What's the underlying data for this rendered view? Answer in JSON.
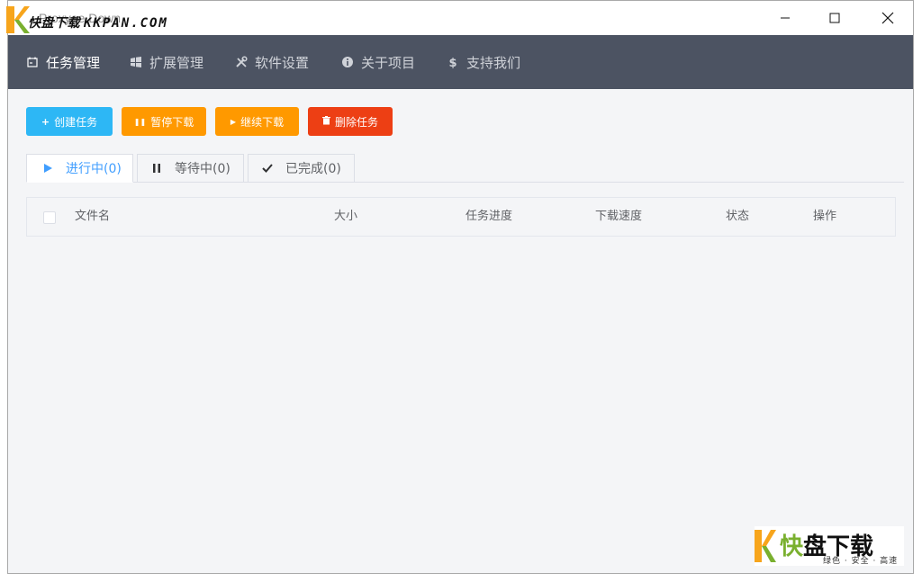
{
  "window": {
    "title": "Proxyee Down",
    "watermark_brand": "快盘下载",
    "watermark_domain": "KKPAN.COM"
  },
  "nav": {
    "items": [
      {
        "label": "任务管理",
        "icon": "calendar-icon",
        "active": true
      },
      {
        "label": "扩展管理",
        "icon": "windows-icon",
        "active": false
      },
      {
        "label": "软件设置",
        "icon": "tools-icon",
        "active": false
      },
      {
        "label": "关于项目",
        "icon": "info-icon",
        "active": false
      },
      {
        "label": "支持我们",
        "icon": "dollar-icon",
        "active": false
      }
    ]
  },
  "toolbar": {
    "create": {
      "label": "创建任务",
      "icon": "+",
      "color": "#2db7f5"
    },
    "pause": {
      "label": "暂停下载",
      "icon": "❚❚",
      "color": "#ff9900"
    },
    "resume": {
      "label": "继续下载",
      "icon": "▶",
      "color": "#ff9900"
    },
    "delete": {
      "label": "删除任务",
      "icon": "trash-icon",
      "color": "#ed3f14"
    }
  },
  "tabs": [
    {
      "label": "进行中(0)",
      "icon": "play-icon",
      "active": true
    },
    {
      "label": "等待中(0)",
      "icon": "pause-icon",
      "active": false
    },
    {
      "label": "已完成(0)",
      "icon": "check-icon",
      "active": false
    }
  ],
  "table": {
    "columns": [
      "文件名",
      "大小",
      "任务进度",
      "下载速度",
      "状态",
      "操作"
    ]
  },
  "logo_watermark": {
    "big_1": "快",
    "big_2": "盘下载",
    "slogan": "绿色 · 安全 · 高速"
  },
  "colors": {
    "nav_bg": "#4c5362",
    "active_tab": "#409eff"
  }
}
